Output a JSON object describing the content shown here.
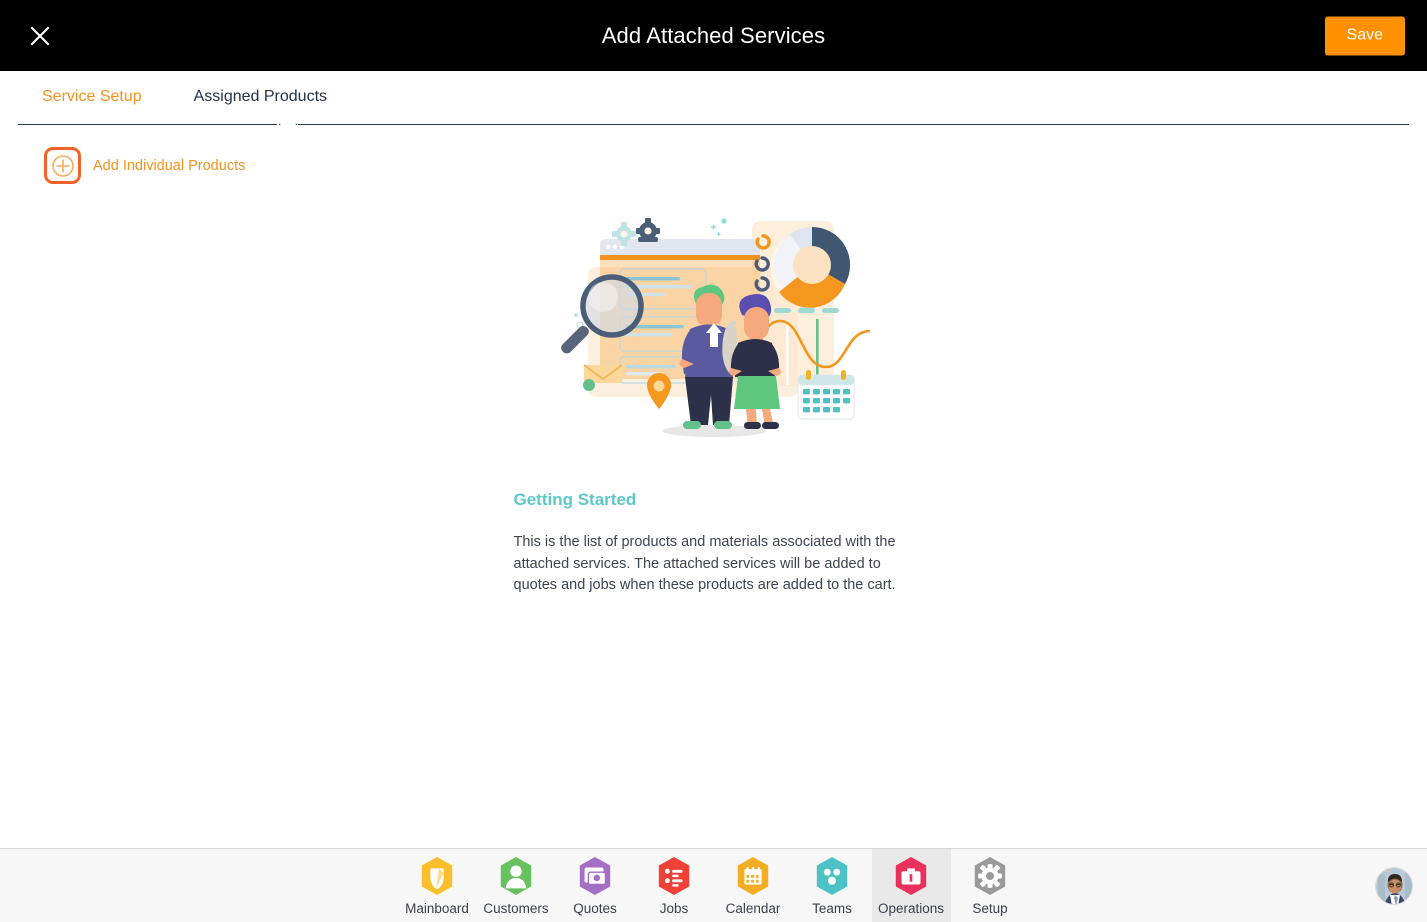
{
  "header": {
    "title": "Add Attached Services",
    "close_icon": "close-icon",
    "save_label": "Save",
    "save_color": "#ff9100"
  },
  "tabs": {
    "items": [
      {
        "label": "Service Setup",
        "active": false
      },
      {
        "label": "Assigned Products",
        "active": true
      }
    ],
    "active_color": "#263248",
    "inactive_color": "#f5921e"
  },
  "toolbar": {
    "add_products_label": "Add Individual Products",
    "add_products_icon": "plus-icon",
    "accent_color": "#f4622a"
  },
  "empty_state": {
    "illustration_icon": "team-analytics-illustration",
    "title": "Getting Started",
    "title_color": "#5ec8c8",
    "body": "This is the list of products and materials associated with the attached services. The attached services will be added to quotes and jobs when these products are added to the cart."
  },
  "bottom_nav": {
    "items": [
      {
        "label": "Mainboard",
        "icon": "mainboard-icon",
        "color": "#fbbf2b",
        "selected": false
      },
      {
        "label": "Customers",
        "icon": "customers-icon",
        "color": "#67c15e",
        "selected": false
      },
      {
        "label": "Quotes",
        "icon": "quotes-icon",
        "color": "#a56fc4",
        "selected": false
      },
      {
        "label": "Jobs",
        "icon": "jobs-icon",
        "color": "#ef4136",
        "selected": false
      },
      {
        "label": "Calendar",
        "icon": "calendar-icon",
        "color": "#f5ae24",
        "selected": false
      },
      {
        "label": "Teams",
        "icon": "teams-icon",
        "color": "#4cc2c4",
        "selected": false
      },
      {
        "label": "Operations",
        "icon": "operations-icon",
        "color": "#e8325c",
        "selected": true
      },
      {
        "label": "Setup",
        "icon": "setup-icon",
        "color": "#9a9a9a",
        "selected": false
      }
    ],
    "avatar_icon": "user-avatar",
    "selected_bg": "#e9e9e9"
  }
}
